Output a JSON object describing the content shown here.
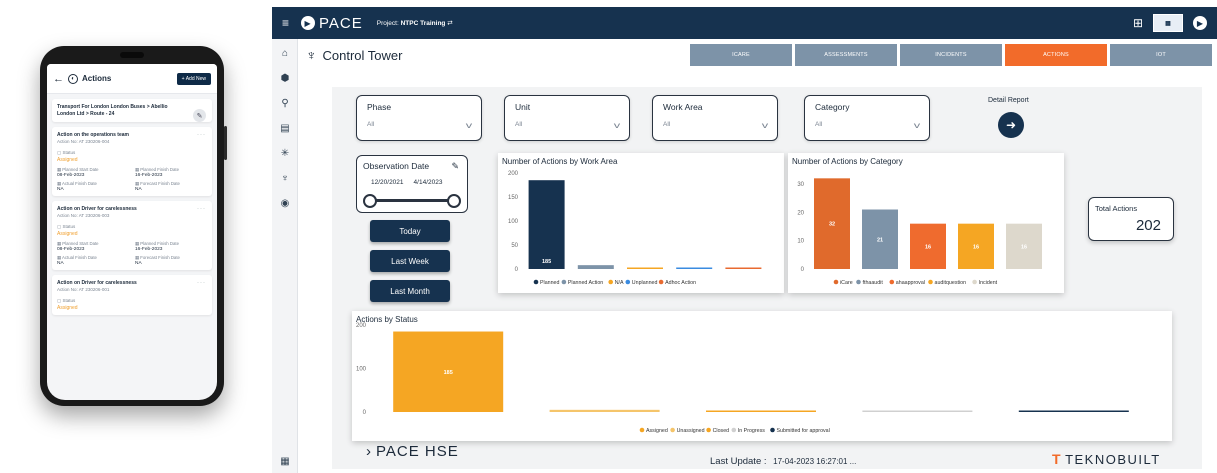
{
  "mobile": {
    "title": "Actions",
    "add_new": "+ Add New",
    "route": "Transport For London London Buses > Abellio London Ltd > Route - 24",
    "cards": [
      {
        "title": "Action on the operations team",
        "action_no": "Action No: AT 230206-004",
        "status_label": "Status",
        "status": "Assigned",
        "planned_start_label": "Planned Start Date",
        "planned_start": "08-Feb-2023",
        "planned_finish_label": "Planned Finish Date",
        "planned_finish": "16-Feb-2023",
        "actual_finish_label": "Actual Finish Date",
        "actual_finish": "NA",
        "forecast_finish_label": "Forecast Finish Date",
        "forecast_finish": "NA"
      },
      {
        "title": "Action on Driver for carelessness",
        "action_no": "Action No: AT 230206-003",
        "status_label": "Status",
        "status": "Assigned",
        "planned_start_label": "Planned Start Date",
        "planned_start": "08-Feb-2023",
        "planned_finish_label": "Planned Finish Date",
        "planned_finish": "16-Feb-2023",
        "actual_finish_label": "Actual Finish Date",
        "actual_finish": "NA",
        "forecast_finish_label": "Forecast Finish Date",
        "forecast_finish": "NA"
      },
      {
        "title": "Action on Driver for carelessness",
        "action_no": "Action No: AT 230206-001",
        "status_label": "Status",
        "status": "Assigned"
      }
    ]
  },
  "topbar": {
    "logo": "PACE",
    "project_label": "Project:",
    "project_name": "NTPC Training"
  },
  "page_title": "Control Tower",
  "nav_tabs": [
    "ICARE",
    "ASSESSMENTS",
    "INCIDENTS",
    "ACTIONS",
    "IOT"
  ],
  "filters": [
    {
      "label": "Phase",
      "value": "All"
    },
    {
      "label": "Unit",
      "value": "All"
    },
    {
      "label": "Work Area",
      "value": "All"
    },
    {
      "label": "Category",
      "value": "All"
    }
  ],
  "detail_report": "Detail Report",
  "observation": {
    "label": "Observation Date",
    "start": "12/20/2021",
    "end": "4/14/2023"
  },
  "quick_buttons": [
    "Today",
    "Last Week",
    "Last Month"
  ],
  "total": {
    "label": "Total Actions",
    "value": "202"
  },
  "footer": {
    "logo": "PACE HSE",
    "last_update_label": "Last Update :",
    "last_update_value": "17-04-2023 16:27:01 ...",
    "brand": "TEKNOBUILT"
  },
  "chart_data": [
    {
      "type": "bar",
      "title": "Number of Actions by Work Area",
      "categories": [
        "Planned",
        "Planned Action",
        "N/A",
        "Unplanned",
        "Adhoc Action"
      ],
      "values": [
        185,
        8,
        3,
        3,
        2
      ],
      "colors": [
        "#16324f",
        "#7d93a8",
        "#f5a623",
        "#3a8be0",
        "#e86a30"
      ],
      "data_labels": [
        "185",
        "",
        "",
        "",
        ""
      ],
      "yticks": [
        0,
        50,
        100,
        150,
        200
      ],
      "ylim": [
        0,
        200
      ]
    },
    {
      "type": "bar",
      "title": "Number of Actions by Category",
      "categories": [
        "iCare",
        "fthaaudit",
        "ahaapproval",
        "auditquestion",
        "Incident"
      ],
      "values": [
        32,
        21,
        16,
        16,
        16
      ],
      "colors": [
        "#e06a2c",
        "#7d93a8",
        "#ef6b2e",
        "#f5a623",
        "#ddd8cc"
      ],
      "data_labels": [
        "32",
        "21",
        "16",
        "16",
        "16"
      ],
      "yticks": [
        0,
        10,
        20,
        30
      ],
      "ylim": [
        0,
        36
      ]
    },
    {
      "type": "bar",
      "title": "Actions by Status",
      "categories": [
        "Assigned",
        "Unassigned",
        "Closed",
        "In Progress",
        "Submitted for approval"
      ],
      "values": [
        185,
        5,
        2,
        1,
        1
      ],
      "colors": [
        "#f5a623",
        "#f5c56b",
        "#f5a623",
        "#d0d0d0",
        "#16324f"
      ],
      "data_labels": [
        "185",
        "",
        "",
        "",
        ""
      ],
      "yticks": [
        0,
        100,
        200
      ],
      "ylim": [
        0,
        200
      ]
    }
  ]
}
